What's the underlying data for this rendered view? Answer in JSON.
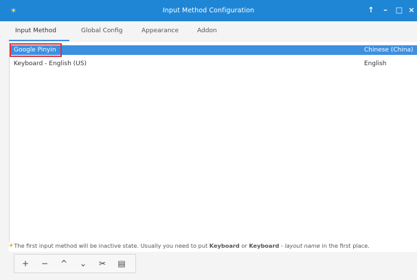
{
  "window": {
    "title": "Input Method Configuration",
    "controls": [
      "↑",
      "–",
      "□",
      "×"
    ],
    "accent": "#1f86d6"
  },
  "tabs": [
    {
      "label": "Input Method",
      "active": true
    },
    {
      "label": "Global Config",
      "active": false
    },
    {
      "label": "Appearance",
      "active": false
    },
    {
      "label": "Addon",
      "active": false
    }
  ],
  "list": {
    "rows": [
      {
        "name": "Google Pinyin",
        "language": "Chinese (China)",
        "selected": true
      },
      {
        "name": "Keyboard - English (US)",
        "language": "English",
        "selected": false
      }
    ]
  },
  "hint": {
    "part1": "The first input method will be inactive state. Usually you need to put ",
    "bold1": "Keyboard",
    "part2": " or ",
    "bold2": "Keyboard",
    "part3": " - ",
    "italic": "layout name",
    "part4": " in the first place."
  },
  "toolbar": {
    "buttons": [
      {
        "name": "add-button",
        "glyph": "+"
      },
      {
        "name": "remove-button",
        "glyph": "−"
      },
      {
        "name": "move-up-button",
        "glyph": "^"
      },
      {
        "name": "move-down-button",
        "glyph": "⌄"
      },
      {
        "name": "configure-button",
        "glyph": "✂"
      },
      {
        "name": "keyboard-layout-button",
        "glyph": "▤"
      }
    ]
  }
}
